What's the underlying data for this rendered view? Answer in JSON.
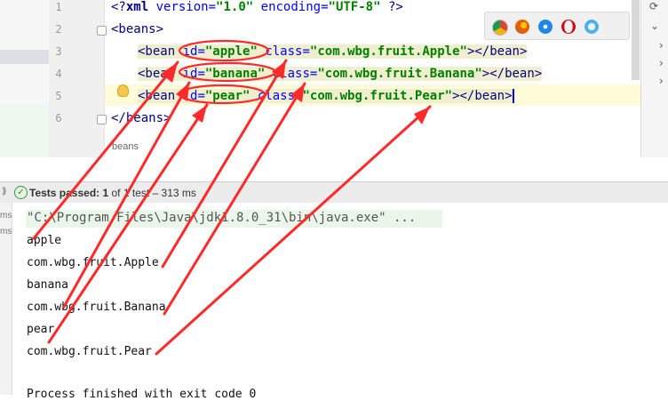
{
  "editor": {
    "line_numbers": [
      "1",
      "2",
      "3",
      "4",
      "5",
      "6"
    ],
    "lines": {
      "l1": {
        "open": "<?",
        "tag": "xml",
        "sp1": " ",
        "a1": "version",
        "eq1": "=",
        "v1": "\"1.0\"",
        "sp2": " ",
        "a2": "encoding",
        "eq2": "=",
        "v2": "\"UTF-8\"",
        "close": " ?>"
      },
      "l2": {
        "text": "<beans>"
      },
      "l3": {
        "open": "<bean ",
        "a1": "id",
        "eq1": "=",
        "v1": "\"apple\"",
        "sp": " ",
        "a2": "class",
        "eq2": "=",
        "v2": "\"com.wbg.fruit.Apple\"",
        "close": "></bean>"
      },
      "l4": {
        "open": "<bean ",
        "a1": "id",
        "eq1": "=",
        "v1": "\"banana\"",
        "sp": " ",
        "a2": "class",
        "eq2": "=",
        "v2": "\"com.wbg.fruit.Banana\"",
        "close": "></bean>"
      },
      "l5": {
        "open": "<bean ",
        "a1": "id",
        "eq1": "=",
        "v1": "\"pear\"",
        "sp": " ",
        "a2": "class",
        "eq2": "=",
        "v2": "\"com.wbg.fruit.Pear\"",
        "close": "></bean>"
      },
      "l6": {
        "text": "</beans>"
      }
    },
    "breadcrumb": "beans"
  },
  "browser_icons": [
    "chrome-icon",
    "firefox-icon",
    "safari-icon",
    "opera-icon",
    "ie-icon"
  ],
  "colors": {
    "arrow": "#ff2a2a",
    "tag": "#000080",
    "attr": "#0000ff",
    "value": "#008000"
  },
  "run": {
    "status_prefix": "Tests passed: ",
    "status_count": "1",
    "status_rest": " of 1 test – 313 ms"
  },
  "console_left": {
    "a": "ms",
    "b": "ms"
  },
  "console": {
    "lines": [
      "\"C:\\Program Files\\Java\\jdk1.8.0_31\\bin\\java.exe\" ...",
      "apple",
      "com.wbg.fruit.Apple",
      "banana",
      "com.wbg.fruit.Banana",
      "pear",
      "com.wbg.fruit.Pear",
      "Process finished with exit code 0"
    ]
  }
}
